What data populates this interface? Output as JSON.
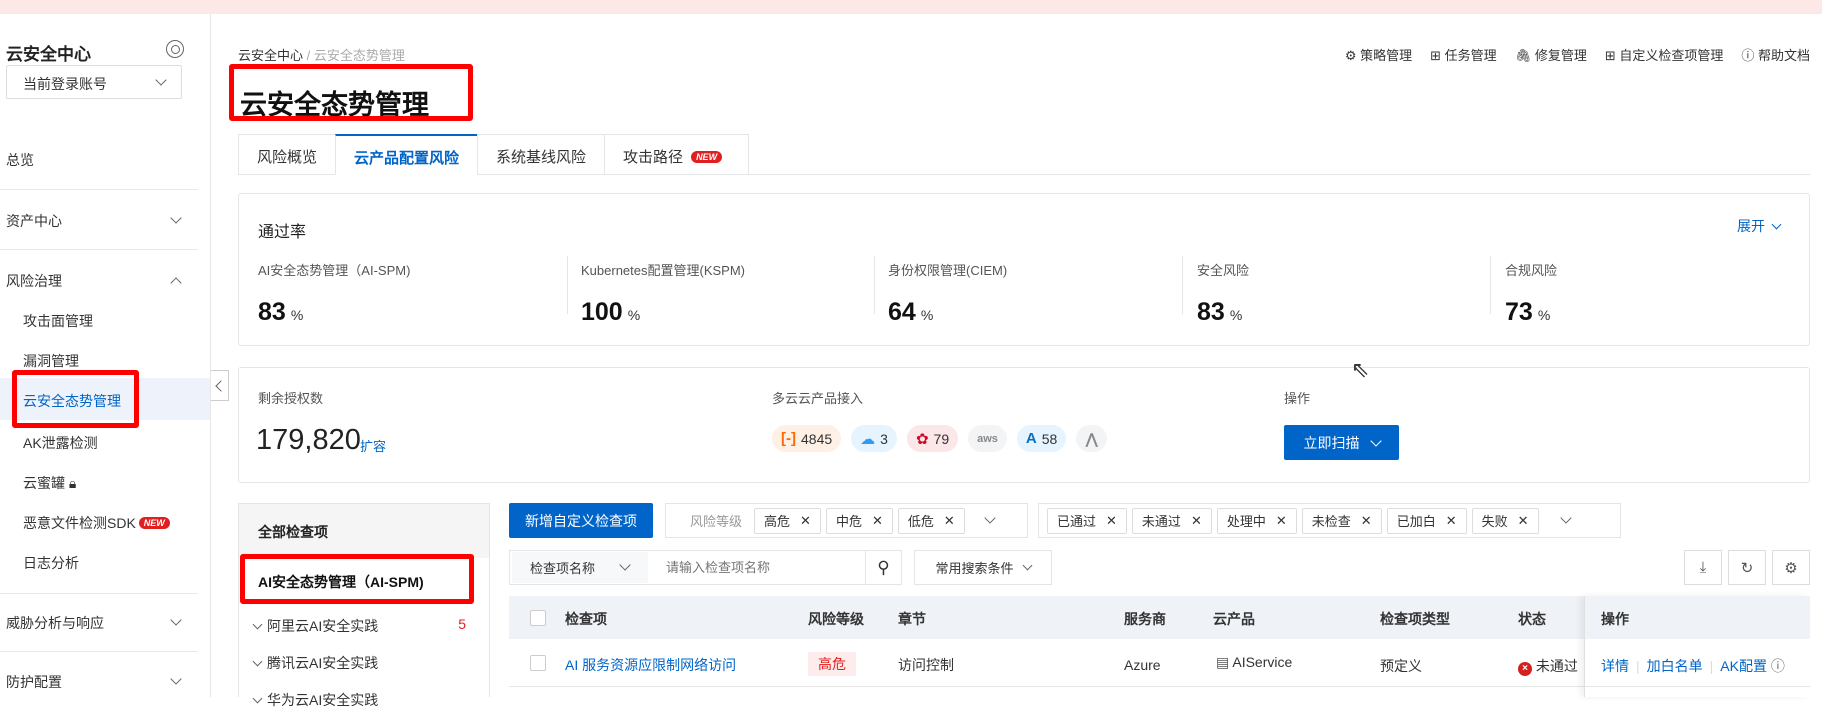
{
  "sidebar": {
    "title": "云安全中心",
    "account": "当前登录账号",
    "items": [
      {
        "label": "总览"
      },
      {
        "label": "资产中心"
      },
      {
        "label": "风险治理"
      },
      {
        "label": "攻击面管理"
      },
      {
        "label": "漏洞管理"
      },
      {
        "label": "云安全态势管理"
      },
      {
        "label": "AK泄露检测"
      },
      {
        "label": "云蜜罐"
      },
      {
        "label": "恶意文件检测SDK",
        "badge": "NEW"
      },
      {
        "label": "日志分析"
      },
      {
        "label": "威胁分析与响应"
      },
      {
        "label": "防护配置"
      }
    ]
  },
  "breadcrumb": {
    "root": "云安全中心",
    "sep": "/",
    "current": "云安全态势管理"
  },
  "page_title": "云安全态势管理",
  "header_links": [
    "策略管理",
    "任务管理",
    "修复管理",
    "自定义检查项管理",
    "帮助文档"
  ],
  "tabs": [
    {
      "label": "风险概览"
    },
    {
      "label": "云产品配置风险"
    },
    {
      "label": "系统基线风险"
    },
    {
      "label": "攻击路径",
      "badge": "NEW"
    }
  ],
  "pass_rate": {
    "title": "通过率",
    "expand": "展开",
    "unit": "%",
    "metrics": [
      {
        "label": "AI安全态势管理（AI-SPM)",
        "value": "83"
      },
      {
        "label": "Kubernetes配置管理(KSPM)",
        "value": "100"
      },
      {
        "label": "身份权限管理(CIEM)",
        "value": "64"
      },
      {
        "label": "安全风险",
        "value": "83"
      },
      {
        "label": "合规风险",
        "value": "73"
      }
    ]
  },
  "license": {
    "label": "剩余授权数",
    "value": "179,820",
    "expand": "扩容"
  },
  "multicloud": {
    "label": "多云云产品接入",
    "providers": [
      {
        "icon": "aliyun-icon",
        "count": "4845",
        "color": "#ff6a00",
        "bg": "#fff0e6"
      },
      {
        "icon": "tencent-cloud-icon",
        "count": "3",
        "color": "#2a9df4",
        "bg": "#e6f4ff"
      },
      {
        "icon": "huawei-icon",
        "count": "79",
        "color": "#cf0a2c",
        "bg": "#fbe6e8"
      },
      {
        "icon": "aws-icon",
        "count": null,
        "text": "aws",
        "color": "#888",
        "bg": "#f3f4f6"
      },
      {
        "icon": "azure-icon",
        "count": "58",
        "color": "#0a6fc2",
        "bg": "#e6f4ff"
      },
      {
        "icon": "other-cloud-icon",
        "count": null,
        "color": "#888",
        "bg": "#f3f4f6"
      }
    ]
  },
  "actions": {
    "label": "操作",
    "scan": "立即扫描"
  },
  "left_panel": {
    "header": "全部检查项",
    "selected": "AI安全态势管理（AI-SPM)",
    "items": [
      {
        "label": "阿里云AI安全实践",
        "count": "5"
      },
      {
        "label": "腾讯云AI安全实践"
      },
      {
        "label": "华为云AI安全实践"
      }
    ]
  },
  "toolbar": {
    "add": "新增自定义检查项",
    "risk_label": "风险等级",
    "risk_tags": [
      "高危",
      "中危",
      "低危"
    ],
    "status_tags": [
      "已通过",
      "未通过",
      "处理中",
      "未检查",
      "已加白",
      "失败"
    ],
    "search_field": "检查项名称",
    "search_placeholder": "请输入检查项名称",
    "saved_search": "常用搜索条件"
  },
  "table": {
    "columns": [
      "检查项",
      "风险等级",
      "章节",
      "服务商",
      "云产品",
      "检查项类型",
      "状态",
      "操作"
    ],
    "rows": [
      {
        "name": "AI 服务资源应限制网络访问",
        "risk": "高危",
        "chapter": "访问控制",
        "vendor": "Azure",
        "product": "AIService",
        "type": "预定义",
        "status": "未通过",
        "ops": [
          "详情",
          "加白名单",
          "AK配置"
        ]
      }
    ]
  }
}
